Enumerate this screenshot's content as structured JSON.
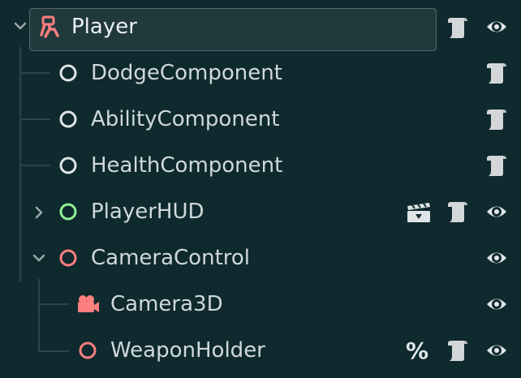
{
  "scene_tree": {
    "root": {
      "label": "Player",
      "icon": "person-icon",
      "expanded": true,
      "buttons": [
        "script-icon",
        "visibility-eye-icon"
      ]
    },
    "nodes": [
      {
        "label": "DodgeComponent",
        "icon": "node-circle-icon",
        "icon_color": "#dfe5e7",
        "buttons": [
          "script-icon"
        ]
      },
      {
        "label": "AbilityComponent",
        "icon": "node-circle-icon",
        "icon_color": "#dfe5e7",
        "buttons": [
          "script-icon"
        ]
      },
      {
        "label": "HealthComponent",
        "icon": "node-circle-icon",
        "icon_color": "#dfe5e7",
        "buttons": [
          "script-icon"
        ]
      },
      {
        "label": "PlayerHUD",
        "icon": "control-circle-icon",
        "icon_color": "#8eef97",
        "expanded": false,
        "buttons": [
          "instance-clapper-icon",
          "script-icon",
          "visibility-eye-icon"
        ]
      },
      {
        "label": "CameraControl",
        "icon": "node3d-circle-icon",
        "icon_color": "#fc7f7f",
        "expanded": true,
        "buttons": [
          "visibility-eye-icon"
        ]
      },
      {
        "label": "Camera3D",
        "icon": "camera-icon",
        "icon_color": "#fc7f7f",
        "buttons": [
          "visibility-eye-icon"
        ]
      },
      {
        "label": "WeaponHolder",
        "icon": "node3d-circle-icon",
        "icon_color": "#fc7f7f",
        "unique_name_marker": "%",
        "buttons": [
          "script-icon",
          "visibility-eye-icon"
        ]
      }
    ]
  }
}
